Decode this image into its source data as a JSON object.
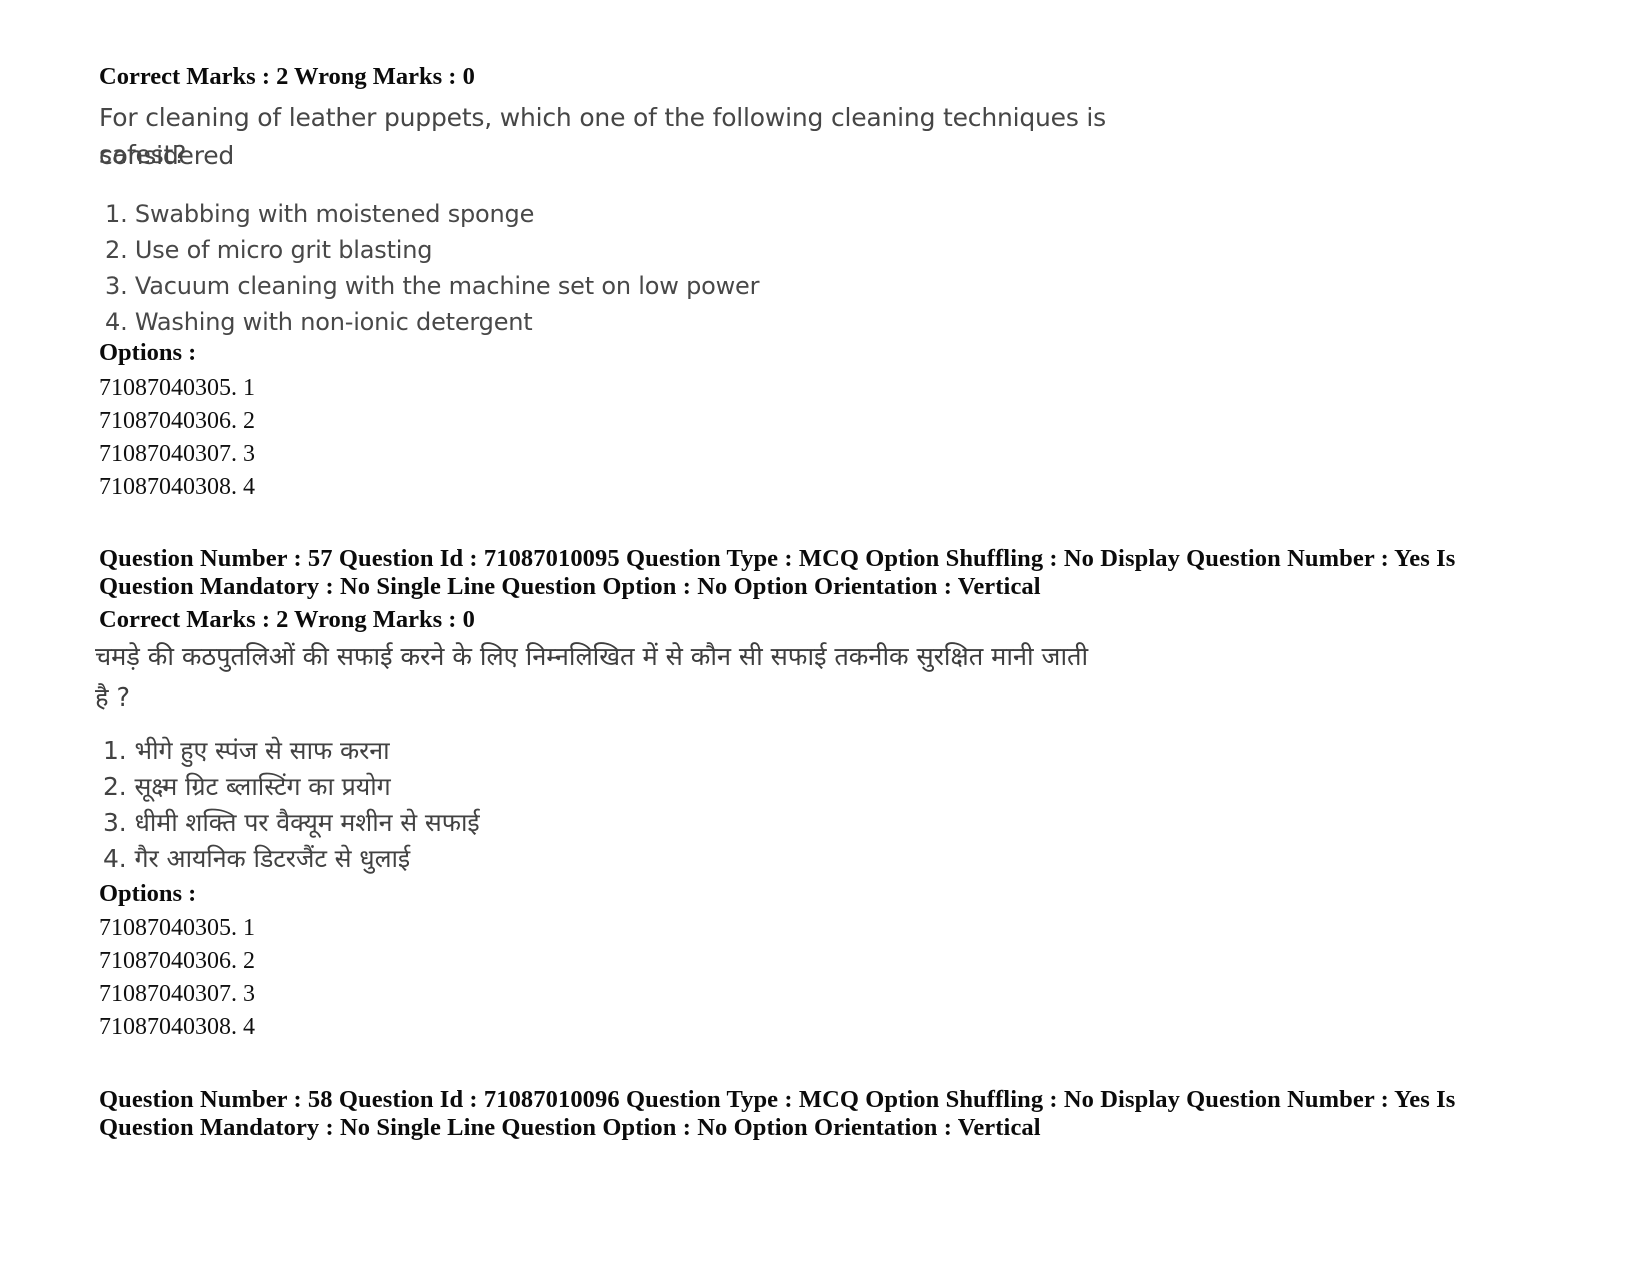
{
  "document": {
    "type": "exam-question-paper-scan",
    "page_background": "#ffffff",
    "text_color": "#000000"
  },
  "question_56_tail": {
    "marks_line": "Correct Marks : 2 Wrong Marks : 0",
    "question_text_line1": "For cleaning of leather puppets, which one of the following cleaning techniques is considered",
    "question_text_line2": "safest?",
    "choices": [
      "1. Swabbing with moistened sponge",
      "2. Use of micro grit blasting",
      "3. Vacuum cleaning with the machine set on low power",
      "4. Washing with non-ionic detergent"
    ],
    "options_label": "Options :",
    "option_ids": [
      "71087040305. 1",
      "71087040306. 2",
      "71087040307. 3",
      "71087040308. 4"
    ]
  },
  "question_57": {
    "header_line1": "Question Number : 57 Question Id : 71087010095 Question Type : MCQ Option Shuffling : No Display Question Number : Yes Is",
    "header_line2": "Question Mandatory : No Single Line Question Option : No Option Orientation : Vertical",
    "marks_line": "Correct Marks : 2 Wrong Marks : 0",
    "question_text_line1": "चमड़े की कठपुतलिओं की सफाई करने के लिए निम्नलिखित में से कौन सी सफाई तकनीक सुरक्षित मानी जाती",
    "question_text_line2": "है ?",
    "choices": [
      "1. भीगे हुए स्पंज से साफ करना",
      "2. सूक्ष्म ग्रिट ब्लास्टिंग का प्रयोग",
      "3. धीमी शक्ति पर वैक्यूम मशीन से सफाई",
      "4. गैर आयनिक डिटरजैंट से धुलाई"
    ],
    "options_label": "Options :",
    "option_ids": [
      "71087040305. 1",
      "71087040306. 2",
      "71087040307. 3",
      "71087040308. 4"
    ]
  },
  "question_58": {
    "header_line1": "Question Number : 58 Question Id : 71087010096 Question Type : MCQ Option Shuffling : No Display Question Number : Yes Is",
    "header_line2": "Question Mandatory : No Single Line Question Option : No Option Orientation : Vertical"
  }
}
